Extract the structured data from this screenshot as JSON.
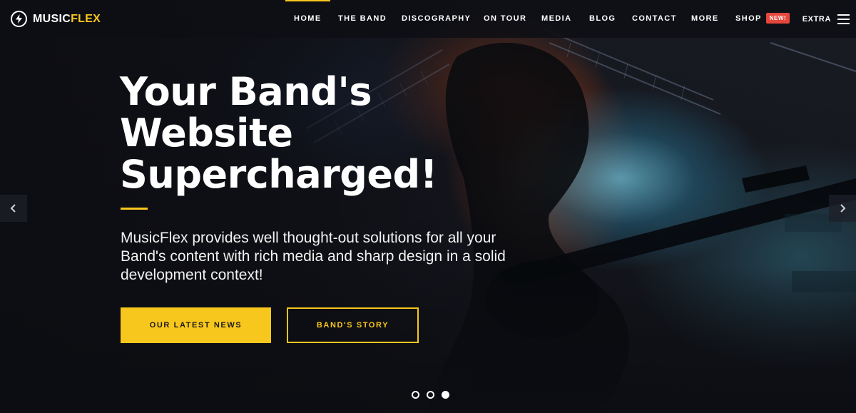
{
  "brand": {
    "name_part1": "MUSIC",
    "name_part2": "FLEX",
    "logo_icon": "bolt-icon",
    "accent_color": "#f8c71d"
  },
  "nav": {
    "items": [
      {
        "label": "HOME",
        "active": true
      },
      {
        "label": "THE BAND"
      },
      {
        "label": "DISCOGRAPHY"
      },
      {
        "label": "ON TOUR"
      },
      {
        "label": "MEDIA"
      },
      {
        "label": "BLOG"
      },
      {
        "label": "CONTACT"
      },
      {
        "label": "MORE"
      },
      {
        "label": "SHOP",
        "badge": "NEW!"
      }
    ],
    "extra_label": "EXTRA",
    "menu_icon": "hamburger-icon",
    "badge_color": "#e5473d"
  },
  "hero": {
    "headline_lines": [
      "Your Band's",
      "Website",
      "Supercharged!"
    ],
    "lead": "MusicFlex provides well thought-out solutions for all your Band's content with rich media and sharp design in a solid development context!",
    "primary_button": "OUR LATEST NEWS",
    "secondary_button": "BAND'S STORY"
  },
  "slider": {
    "prev_icon": "chevron-left-icon",
    "next_icon": "chevron-right-icon",
    "slides_total": 3,
    "active_slide": 3
  }
}
